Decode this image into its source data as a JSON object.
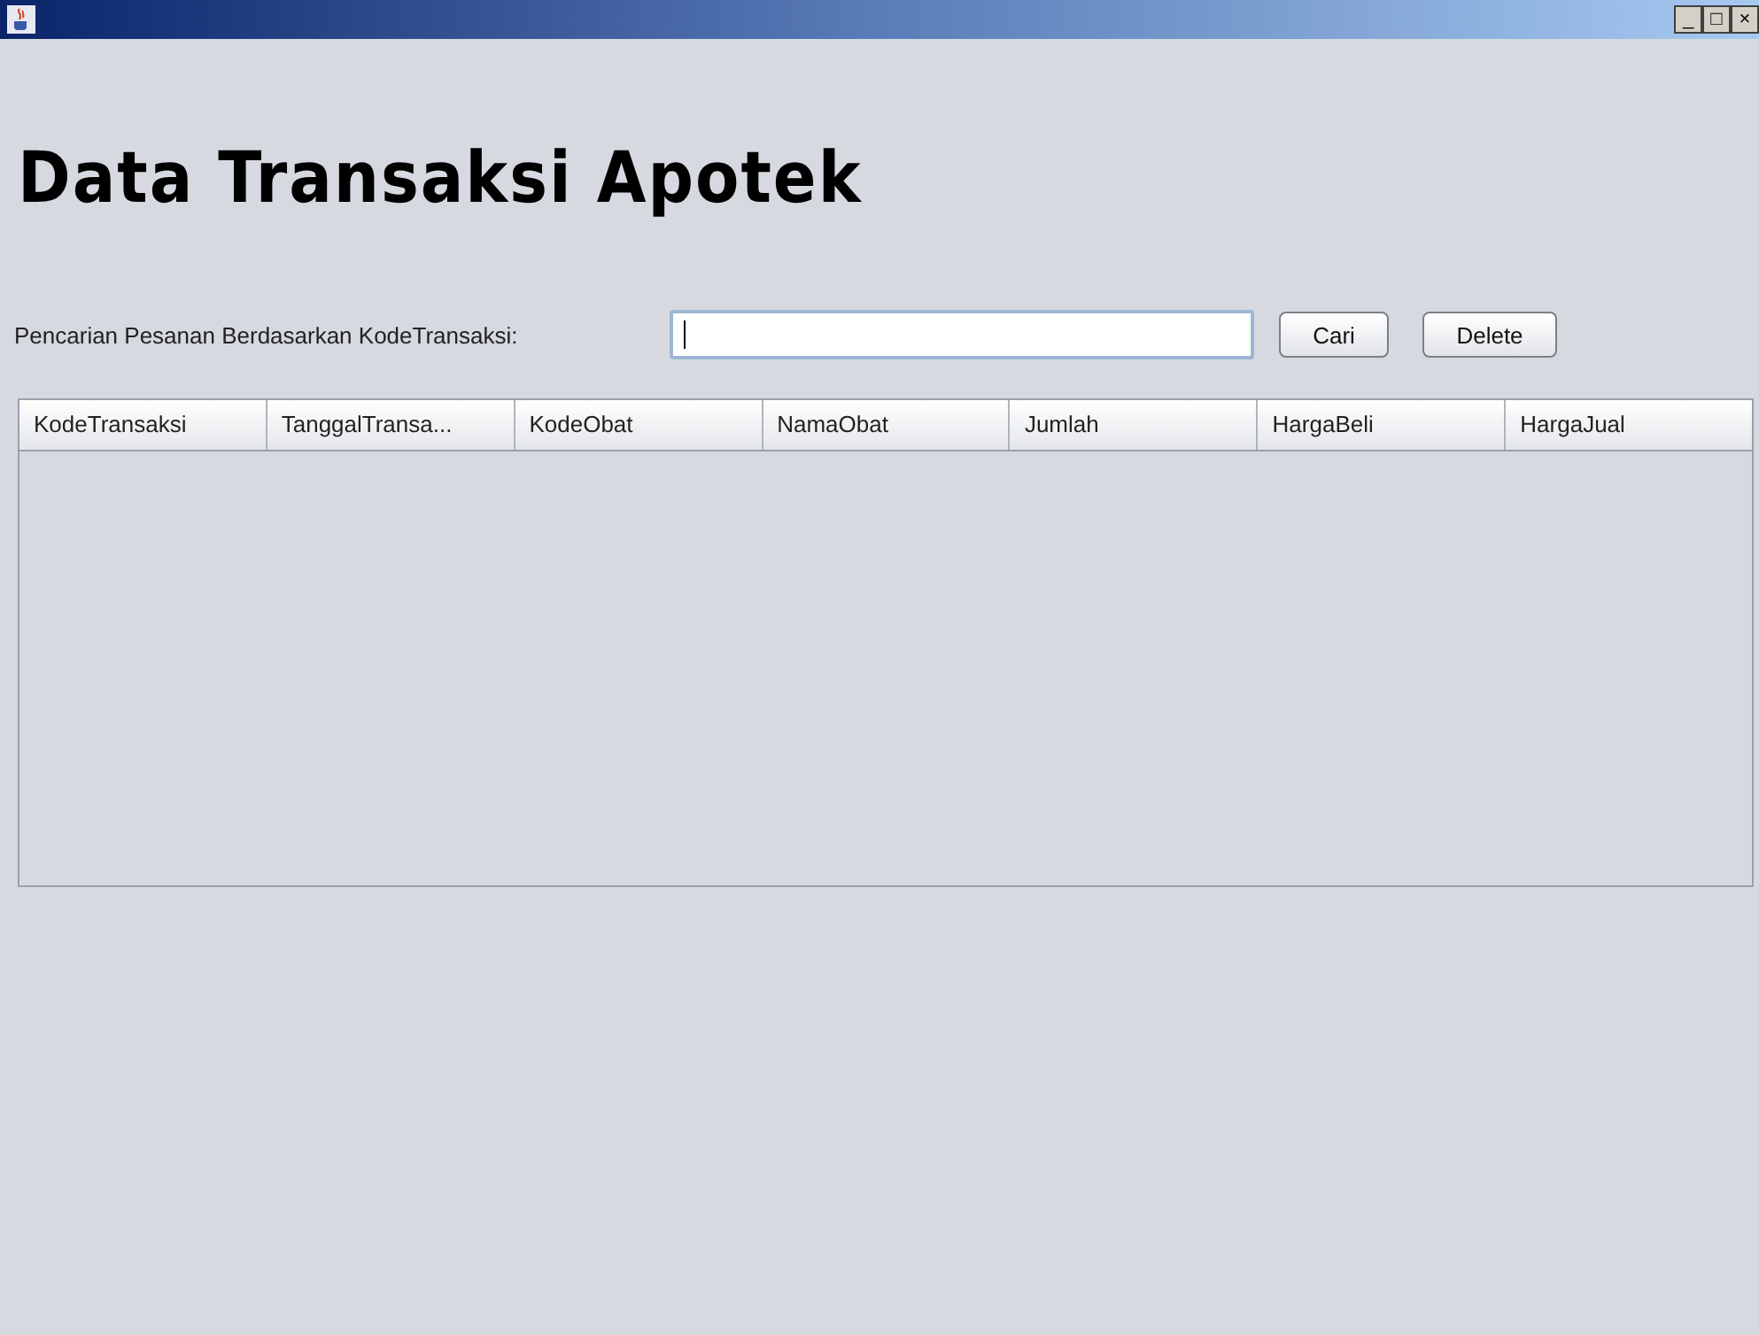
{
  "window": {
    "title_bar_buttons": [
      "_",
      "□",
      "×"
    ]
  },
  "heading": "Data Transaksi Apotek",
  "search": {
    "label": "Pencarian Pesanan Berdasarkan KodeTransaksi:"
  },
  "buttons": [
    "Cari",
    "Delete"
  ],
  "table": {
    "columns": [
      "KodeTransaksi",
      "TanggalTransa...",
      "KodeObat",
      "NamaObat",
      "Jumlah",
      "HargaBeli",
      "HargaJual"
    ]
  }
}
